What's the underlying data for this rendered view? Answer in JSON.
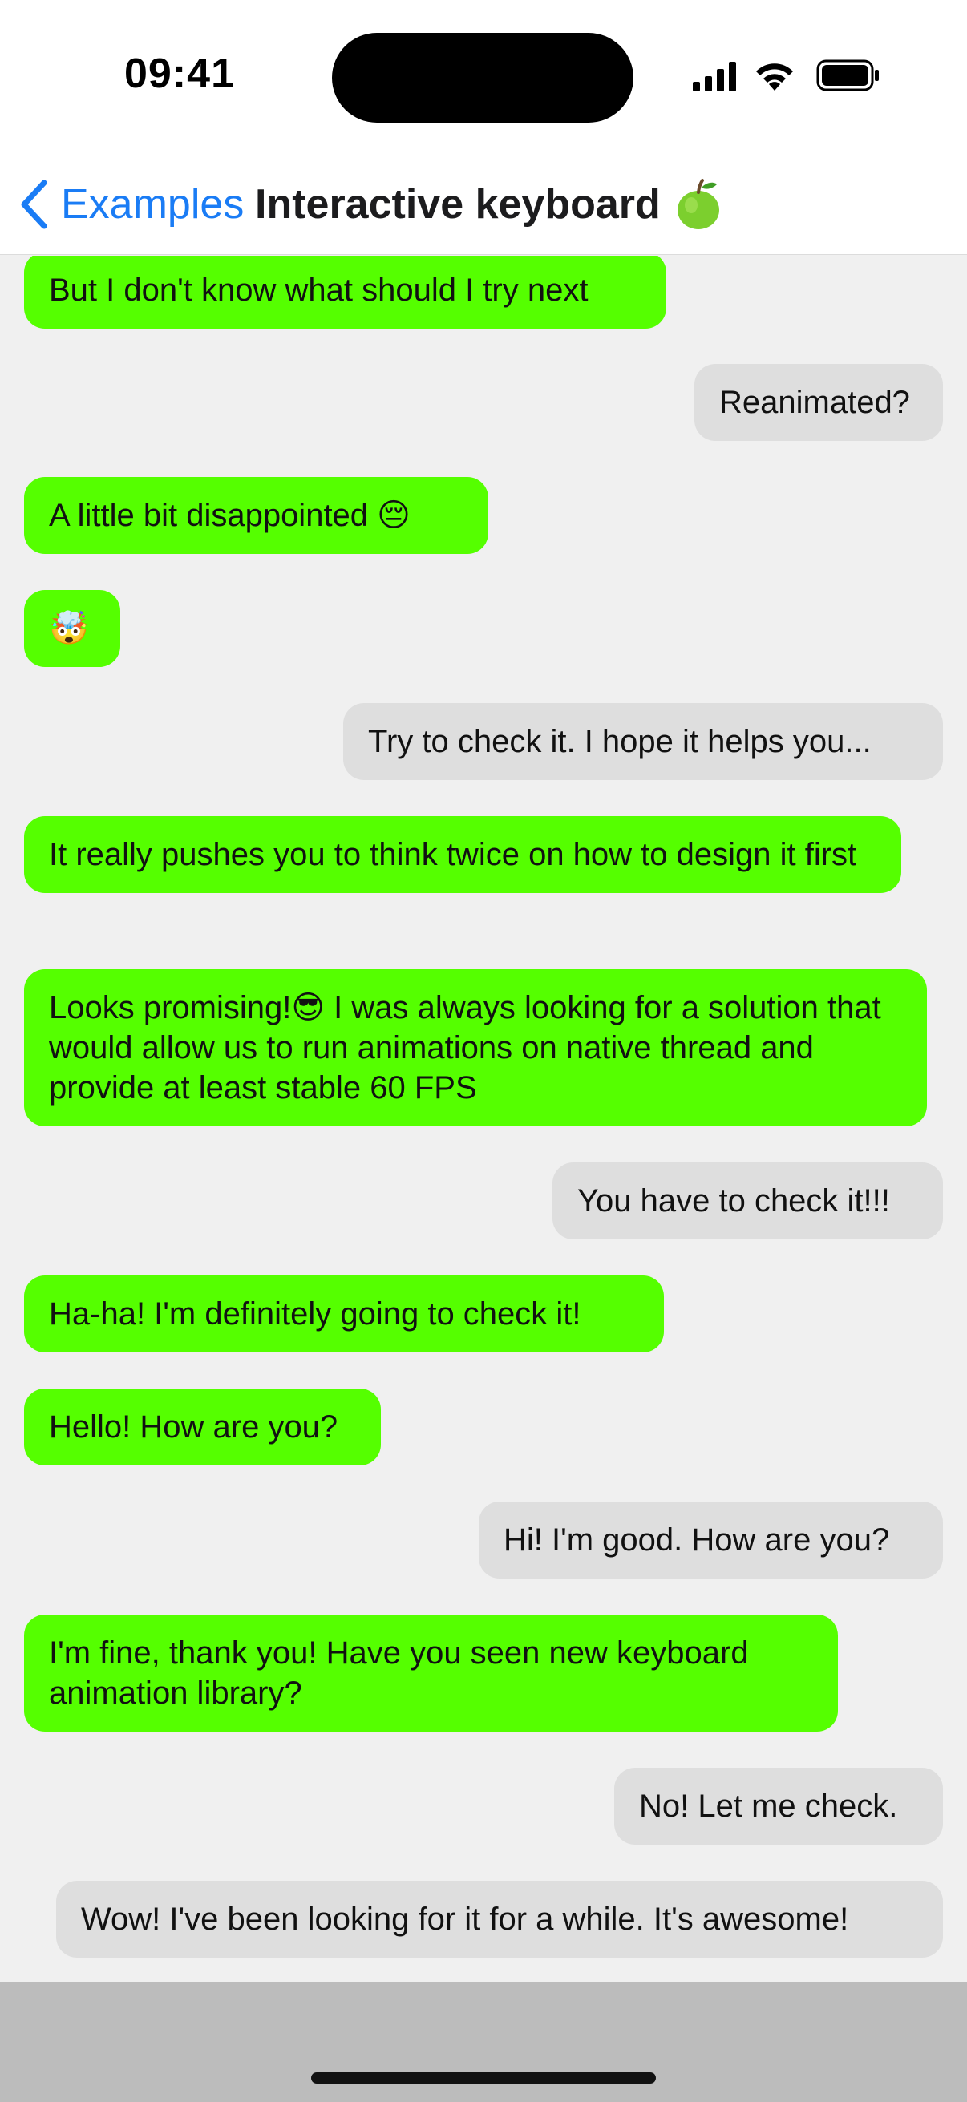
{
  "status_bar": {
    "time": "09:41",
    "icons": [
      "signal-icon",
      "wifi-icon",
      "battery-icon"
    ]
  },
  "nav": {
    "back_label": "Examples",
    "title": "Interactive keyboard",
    "title_icon": "green-apple-icon",
    "back_color": "#1a7cf5"
  },
  "colors": {
    "incoming_bubble": "#55ff00",
    "outgoing_bubble": "#dedede",
    "chat_background": "#f0f0f0",
    "keyboard_area": "#bcbcbc"
  },
  "messages": [
    {
      "side": "in",
      "text": "But I don't know what should I try next"
    },
    {
      "side": "out",
      "text": "Reanimated?"
    },
    {
      "side": "in",
      "text": "A little bit disappointed 😔"
    },
    {
      "side": "in",
      "text": "🤯"
    },
    {
      "side": "out",
      "text": "Try to check it. I hope it helps you..."
    },
    {
      "side": "in",
      "text": "It really pushes you to think twice on how to design it first"
    },
    {
      "side": "in",
      "text": "Looks promising!😎 I was always looking for a solution that would allow us to run animations on native thread and provide at least stable 60 FPS"
    },
    {
      "side": "out",
      "text": "You have to check it!!!"
    },
    {
      "side": "in",
      "text": "Ha-ha! I'm definitely going to check it!"
    },
    {
      "side": "in",
      "text": "Hello! How are you?"
    },
    {
      "side": "out",
      "text": "Hi! I'm good. How are you?"
    },
    {
      "side": "in",
      "text": "I'm fine, thank you! Have you seen new keyboard animation library?"
    },
    {
      "side": "out",
      "text": "No! Let me check."
    },
    {
      "side": "out",
      "text": "Wow! I've been looking for it for a while. It's awesome!"
    }
  ]
}
